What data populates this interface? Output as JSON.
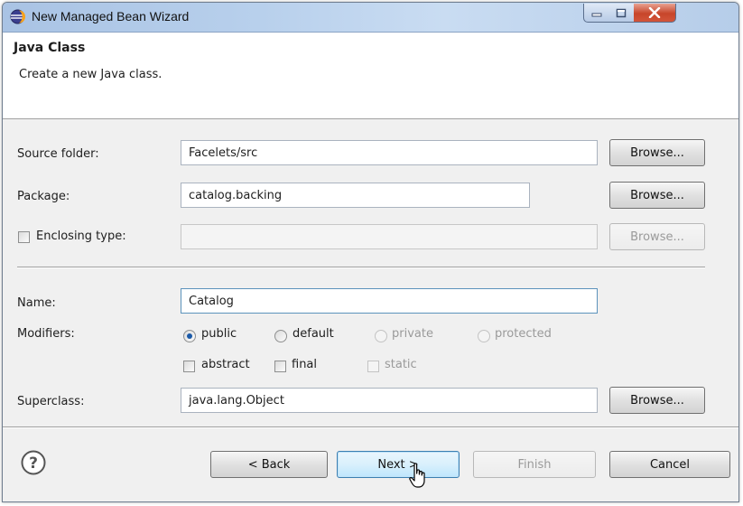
{
  "window": {
    "title": "New Managed Bean Wizard",
    "icon": "eclipse-icon",
    "controls": {
      "minimize": "minimize-icon",
      "maximize": "maximize-icon",
      "close": "close-icon"
    }
  },
  "header": {
    "title": "Java Class",
    "description": "Create a new Java class."
  },
  "form": {
    "source_folder": {
      "label": "Source folder:",
      "value": "Facelets/src",
      "button": "Browse..."
    },
    "package": {
      "label": "Package:",
      "value": "catalog.backing",
      "button": "Browse..."
    },
    "enclosing_type": {
      "label": "Enclosing type:",
      "checked": false,
      "value": "",
      "button": "Browse..."
    },
    "name": {
      "label": "Name:",
      "value": "Catalog"
    },
    "modifiers": {
      "label": "Modifiers:",
      "radios": [
        {
          "label": "public",
          "selected": true,
          "enabled": true
        },
        {
          "label": "default",
          "selected": false,
          "enabled": true
        },
        {
          "label": "private",
          "selected": false,
          "enabled": false
        },
        {
          "label": "protected",
          "selected": false,
          "enabled": false
        }
      ],
      "checkboxes": [
        {
          "label": "abstract",
          "checked": false,
          "enabled": true
        },
        {
          "label": "final",
          "checked": false,
          "enabled": true
        },
        {
          "label": "static",
          "checked": false,
          "enabled": false
        }
      ]
    },
    "superclass": {
      "label": "Superclass:",
      "value": "java.lang.Object",
      "button": "Browse..."
    }
  },
  "footer": {
    "help_icon": "help-icon",
    "back": "< Back",
    "next": "Next >",
    "finish": "Finish",
    "cancel": "Cancel"
  },
  "colors": {
    "titlebar": "#b8d0ec",
    "close_button": "#c7452a",
    "focus_border": "#3c7fb1"
  }
}
